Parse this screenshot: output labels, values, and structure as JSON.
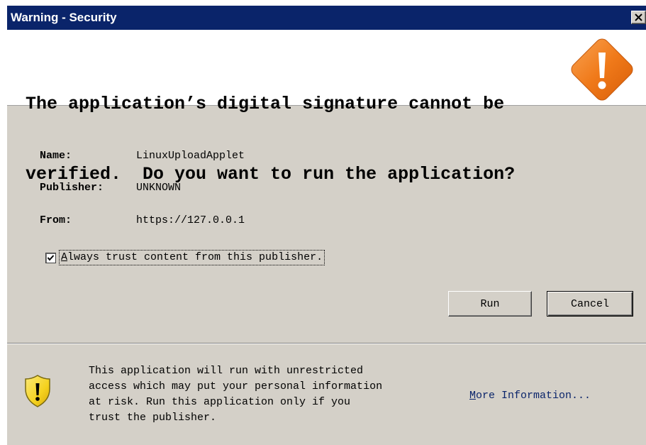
{
  "window": {
    "title": "Warning - Security"
  },
  "header": {
    "headline_line1": "The application’s digital signature cannot be",
    "headline_line2": "verified.  Do you want to run the application?"
  },
  "details": {
    "name_label": "Name:",
    "name_value": "LinuxUploadApplet",
    "publisher_label": "Publisher:",
    "publisher_value": "UNKNOWN",
    "from_label": "From:",
    "from_value": "https://127.0.0.1"
  },
  "trust_checkbox": {
    "checked": true,
    "label_first": "A",
    "label_rest": "lways trust content from this publisher."
  },
  "buttons": {
    "run_label": "Run",
    "cancel_label": "Cancel"
  },
  "footer": {
    "message_lines": [
      "This application will run with unrestricted",
      "access which may put your personal information",
      "at risk. Run this application only if you",
      "trust the publisher."
    ],
    "more_info_first": "M",
    "more_info_rest": "ore Information..."
  },
  "icons": {
    "title_close": "close-icon",
    "header_warning": "warning-diamond-icon",
    "checkbox_mark": "checkmark-icon",
    "footer_warning": "warning-shield-icon"
  },
  "colors": {
    "titlebar": "#0a246a",
    "dialog_face": "#d4d0c8",
    "warning_orange": "#f07a1a",
    "shield_yellow": "#f5d21f",
    "link": "#0a246a"
  }
}
